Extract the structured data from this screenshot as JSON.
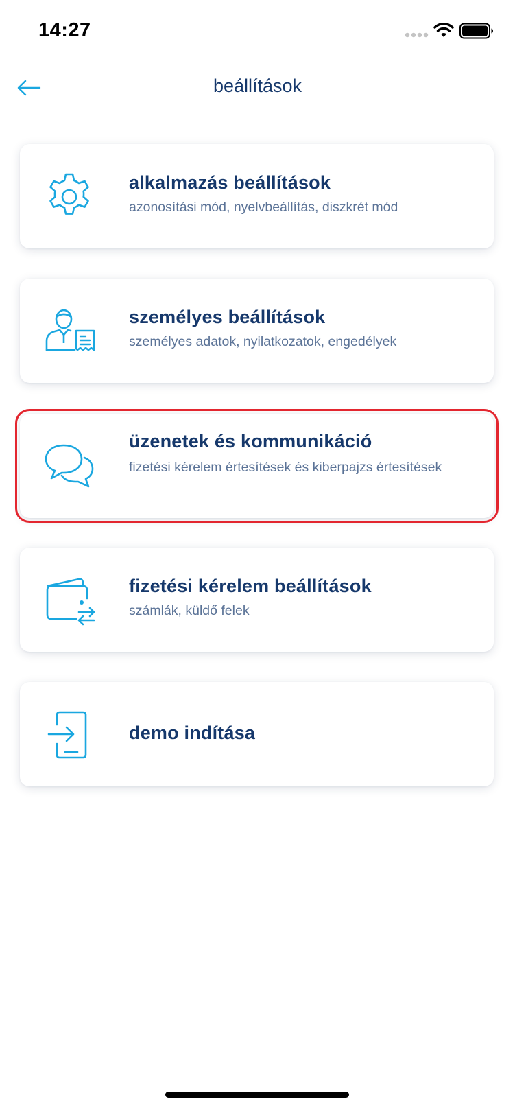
{
  "status_bar": {
    "time": "14:27"
  },
  "header": {
    "title": "beállítások",
    "back_icon": "arrow-left-icon"
  },
  "accent_color": "#1aa7e0",
  "text_color": "#16386b",
  "highlight_color": "#e3262f",
  "cards": [
    {
      "title": "alkalmazás beállítások",
      "subtitle": "azonosítási mód, nyelvbeállítás, diszkrét mód",
      "icon": "gear-icon"
    },
    {
      "title": "személyes beállítások",
      "subtitle": "személyes adatok, nyilatkozatok, engedélyek",
      "icon": "person-document-icon"
    },
    {
      "title": "üzenetek és kommunikáció",
      "subtitle": "fizetési kérelem értesítések és kiberpajzs értesítések",
      "icon": "chat-bubbles-icon",
      "highlighted": true
    },
    {
      "title": "fizetési kérelem beállítások",
      "subtitle": "számlák, küldő felek",
      "icon": "wallet-transfer-icon"
    },
    {
      "title": "demo indítása",
      "subtitle": "",
      "icon": "phone-enter-icon"
    }
  ]
}
